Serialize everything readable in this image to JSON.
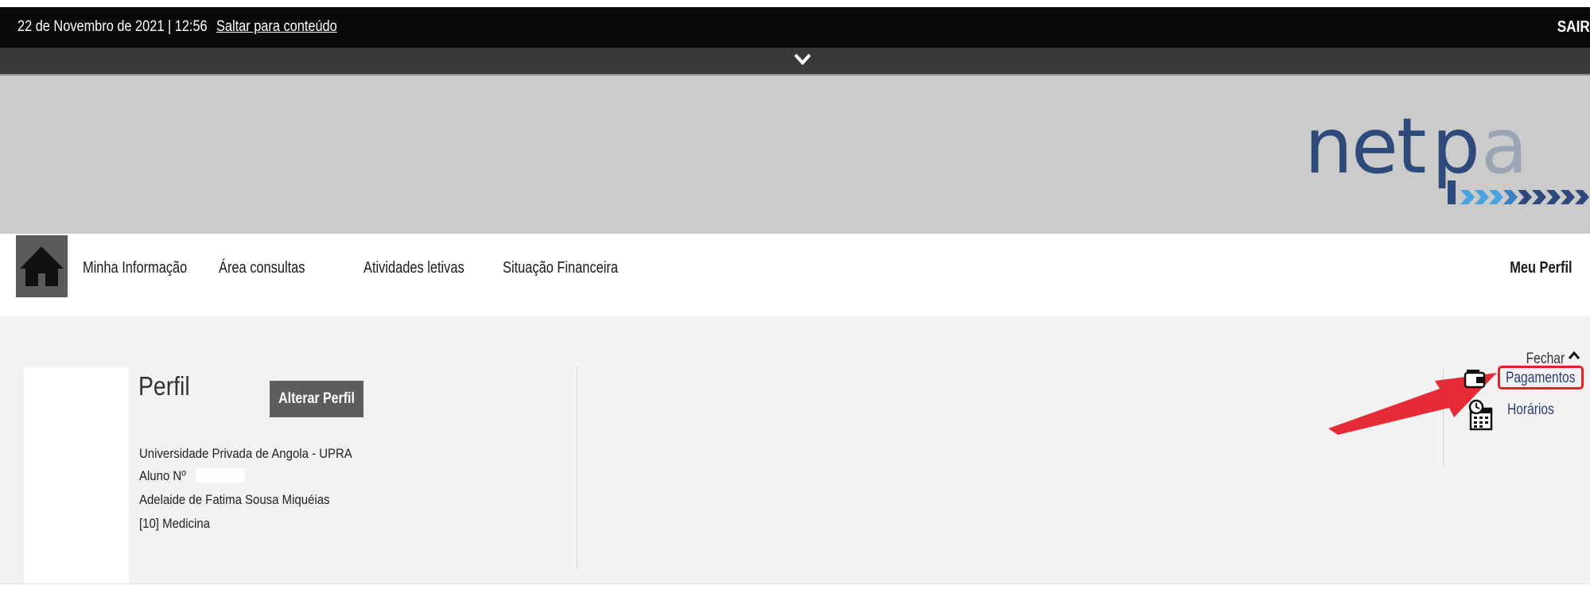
{
  "topbar": {
    "datetime": "22 de Novembro de 2021 | 12:56",
    "skip_link": "Saltar para conteúdo",
    "logout": "SAIR"
  },
  "banner": {
    "logo_text": "netpa",
    "colors": {
      "logo_blue": "#2e4a7a",
      "logo_grey": "#9aa6b4",
      "chevrons": "#4aa3df"
    }
  },
  "nav": {
    "home_icon": "home-icon",
    "items": [
      {
        "label": "Minha Informação"
      },
      {
        "label": "Área consultas"
      },
      {
        "label": "Atividades letivas"
      },
      {
        "label": "Situação Financeira"
      }
    ],
    "profile": "Meu Perfil"
  },
  "panel": {
    "close_label": "Fechar",
    "title": "Perfil",
    "edit_button": "Alterar Perfil",
    "university": "Universidade Privada de Angola - UPRA",
    "student_number_label": "Aluno Nº",
    "student_name": "Adelaide de Fatima Sousa Miquéias",
    "course": "[10] Medicina",
    "quick_links": [
      {
        "label": "Pagamentos",
        "icon": "wallet-icon",
        "highlighted": true
      },
      {
        "label": "Horários",
        "icon": "calendar-icon"
      }
    ],
    "annotation_color": "#e4202a"
  }
}
